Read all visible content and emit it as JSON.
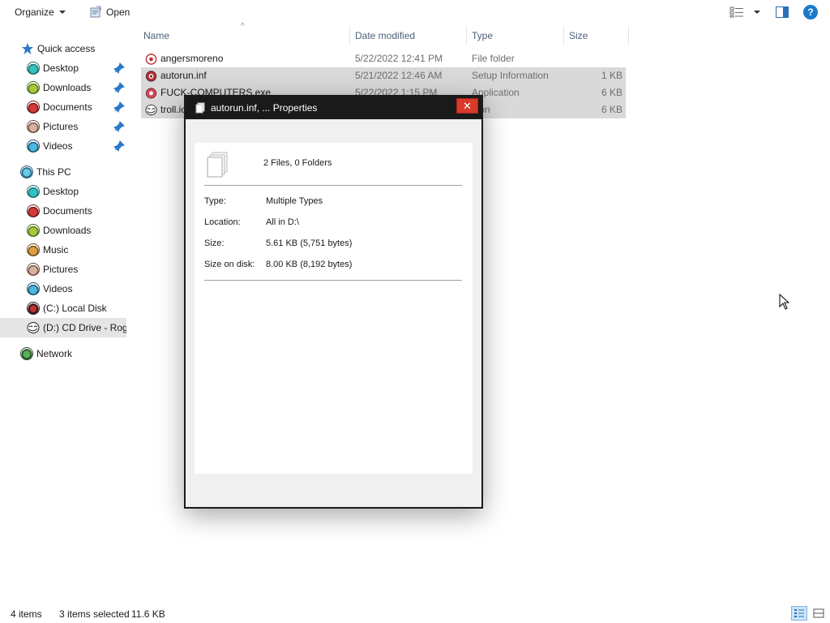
{
  "toolbar": {
    "organize_label": "Organize",
    "open_label": "Open"
  },
  "nav": {
    "quick_access": "Quick access",
    "quick_items": [
      {
        "label": "Desktop",
        "pinned": true
      },
      {
        "label": "Downloads",
        "pinned": true
      },
      {
        "label": "Documents",
        "pinned": true
      },
      {
        "label": "Pictures",
        "pinned": true
      },
      {
        "label": "Videos",
        "pinned": true
      }
    ],
    "this_pc": "This PC",
    "pc_items": [
      {
        "label": "Desktop"
      },
      {
        "label": "Documents"
      },
      {
        "label": "Downloads"
      },
      {
        "label": "Music"
      },
      {
        "label": "Pictures"
      },
      {
        "label": "Videos"
      },
      {
        "label": "(C:) Local Disk"
      },
      {
        "label": "(D:) CD Drive - Rogue"
      }
    ],
    "network": "Network"
  },
  "columns": {
    "name": "Name",
    "date": "Date modified",
    "type": "Type",
    "size": "Size"
  },
  "files": [
    {
      "name": "angersmoreno",
      "date": "5/22/2022 12:41 PM",
      "type": "File folder",
      "size": "",
      "selected": false
    },
    {
      "name": "autorun.inf",
      "date": "5/21/2022 12:46 AM",
      "type": "Setup Information",
      "size": "1 KB",
      "selected": true
    },
    {
      "name": "FUCK-COMPUTERS.exe",
      "date": "5/22/2022 1:15 PM",
      "type": "Application",
      "size": "6 KB",
      "selected": true
    },
    {
      "name": "troll.ico",
      "date": "",
      "type": "Icon",
      "size": "6 KB",
      "selected": true
    }
  ],
  "status": {
    "items": "4 items",
    "selected": "3 items selected",
    "size": "11.6 KB"
  },
  "dialog": {
    "title": "autorun.inf, ... Properties",
    "close_glyph": "✕",
    "summary": "2 Files, 0 Folders",
    "props": [
      {
        "label": "Type:",
        "value": "Multiple Types"
      },
      {
        "label": "Location:",
        "value": "All in D:\\"
      },
      {
        "label": "Size:",
        "value": "5.61 KB (5,751 bytes)"
      },
      {
        "label": "Size on disk:",
        "value": "8.00 KB (8,192 bytes)"
      }
    ]
  },
  "colors": {
    "accent_blue": "#1979ca",
    "selection": "#d9d9d9",
    "nav_selected": "#e5e5e5",
    "close_red": "#d93a2b",
    "title_dark": "#1a1a1a"
  },
  "icons": {
    "help": "?",
    "sort_arrow": "^"
  }
}
